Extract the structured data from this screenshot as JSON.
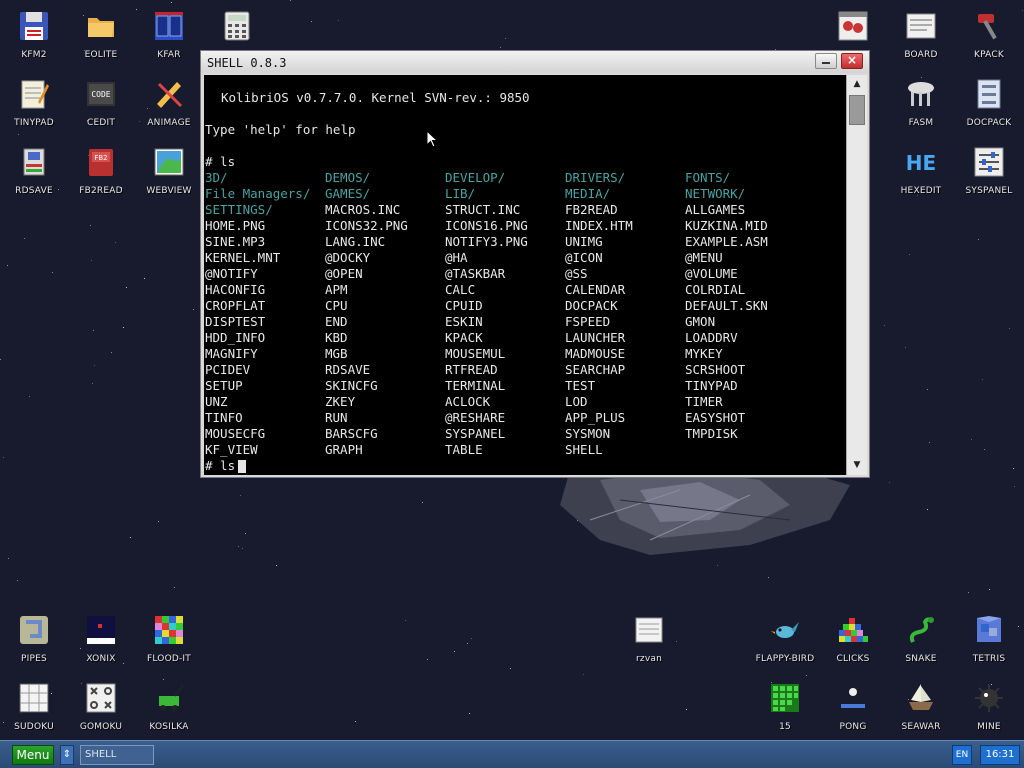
{
  "window": {
    "title": "SHELL 0.8.3",
    "close_glyph": "×"
  },
  "terminal": {
    "banner": "KolibriOS v0.7.7.0. Kernel SVN-rev.: 9850",
    "help_hint": "Type 'help' for help",
    "command": "# ls",
    "prompt_current": "# ls",
    "listing": [
      [
        "3D/",
        "DEMOS/",
        "DEVELOP/",
        "DRIVERS/",
        "FONTS/"
      ],
      [
        "File Managers/",
        "GAMES/",
        "LIB/",
        "MEDIA/",
        "NETWORK/"
      ],
      [
        "SETTINGS/",
        "MACROS.INC",
        "STRUCT.INC",
        "FB2READ",
        "ALLGAMES"
      ],
      [
        "HOME.PNG",
        "ICONS32.PNG",
        "ICONS16.PNG",
        "INDEX.HTM",
        "KUZKINA.MID"
      ],
      [
        "SINE.MP3",
        "LANG.INC",
        "NOTIFY3.PNG",
        "UNIMG",
        "EXAMPLE.ASM"
      ],
      [
        "KERNEL.MNT",
        "@DOCKY",
        "@HA",
        "@ICON",
        "@MENU"
      ],
      [
        "@NOTIFY",
        "@OPEN",
        "@TASKBAR",
        "@SS",
        "@VOLUME"
      ],
      [
        "HACONFIG",
        "APM",
        "CALC",
        "CALENDAR",
        "COLRDIAL"
      ],
      [
        "CROPFLAT",
        "CPU",
        "CPUID",
        "DOCPACK",
        "DEFAULT.SKN"
      ],
      [
        "DISPTEST",
        "END",
        "ESKIN",
        "FSPEED",
        "GMON"
      ],
      [
        "HDD_INFO",
        "KBD",
        "KPACK",
        "LAUNCHER",
        "LOADDRV"
      ],
      [
        "MAGNIFY",
        "MGB",
        "MOUSEMUL",
        "MADMOUSE",
        "MYKEY"
      ],
      [
        "PCIDEV",
        "RDSAVE",
        "RTFREAD",
        "SEARCHAP",
        "SCRSHOOT"
      ],
      [
        "SETUP",
        "SKINCFG",
        "TERMINAL",
        "TEST",
        "TINYPAD"
      ],
      [
        "UNZ",
        "ZKEY",
        "ACLOCK",
        "LOD",
        "TIMER"
      ],
      [
        "TINFO",
        "RUN",
        "@RESHARE",
        "APP_PLUS",
        "EASYSHOT"
      ],
      [
        "MOUSECFG",
        "BARSCFG",
        "SYSPANEL",
        "SYSMON",
        "TMPDISK"
      ],
      [
        "KF_VIEW",
        "GRAPH",
        "TABLE",
        "SHELL",
        ""
      ]
    ],
    "dir_color": "#4aa2a2",
    "file_color": "#e8e8e8"
  },
  "desktop_icons": [
    {
      "label": "KFM2",
      "icon": "floppy-icon"
    },
    {
      "label": "EOLITE",
      "icon": "folder-icon"
    },
    {
      "label": "KFAR",
      "icon": "kfar-icon"
    },
    {
      "label": "",
      "icon": "calculator-icon"
    },
    {
      "label": "TINYPAD",
      "icon": "notepad-icon"
    },
    {
      "label": "CEDIT",
      "icon": "code-icon"
    },
    {
      "label": "ANIMAGE",
      "icon": "pencil-icon"
    },
    {
      "label": "RDSAVE",
      "icon": "rdsave-icon"
    },
    {
      "label": "FB2READ",
      "icon": "book-icon"
    },
    {
      "label": "WEBVIEW",
      "icon": "globe-icon"
    },
    {
      "label": "",
      "icon": "bug-icon"
    },
    {
      "label": "BOARD",
      "icon": "board-icon"
    },
    {
      "label": "KPACK",
      "icon": "hammer-icon"
    },
    {
      "label": "FASM",
      "icon": "fasm-icon"
    },
    {
      "label": "DOCPACK",
      "icon": "docpack-icon"
    },
    {
      "label": "HEXEDIT",
      "icon": "hex-icon"
    },
    {
      "label": "SYSPANEL",
      "icon": "sliders-icon"
    },
    {
      "label": "PIPES",
      "icon": "pipes-icon"
    },
    {
      "label": "XONIX",
      "icon": "xonix-icon"
    },
    {
      "label": "FLOOD-IT",
      "icon": "flood-icon"
    },
    {
      "label": "SUDOKU",
      "icon": "sudoku-icon"
    },
    {
      "label": "GOMOKU",
      "icon": "gomoku-icon"
    },
    {
      "label": "KOSILKA",
      "icon": "mower-icon"
    },
    {
      "label": "rzvan",
      "icon": "file-icon"
    },
    {
      "label": "FLAPPY-BIRD",
      "icon": "bird-icon"
    },
    {
      "label": "CLICKS",
      "icon": "clicks-icon"
    },
    {
      "label": "SNAKE",
      "icon": "snake-icon"
    },
    {
      "label": "TETRIS",
      "icon": "tetris-icon"
    },
    {
      "label": "15",
      "icon": "fifteen-icon"
    },
    {
      "label": "PONG",
      "icon": "pong-icon"
    },
    {
      "label": "SEAWAR",
      "icon": "ship-icon"
    },
    {
      "label": "MINE",
      "icon": "mine-icon"
    }
  ],
  "taskbar": {
    "menu_label": "Menu",
    "arrows_glyph": "⇕",
    "task_label": "SHELL",
    "language": "EN",
    "clock": "16:31"
  }
}
